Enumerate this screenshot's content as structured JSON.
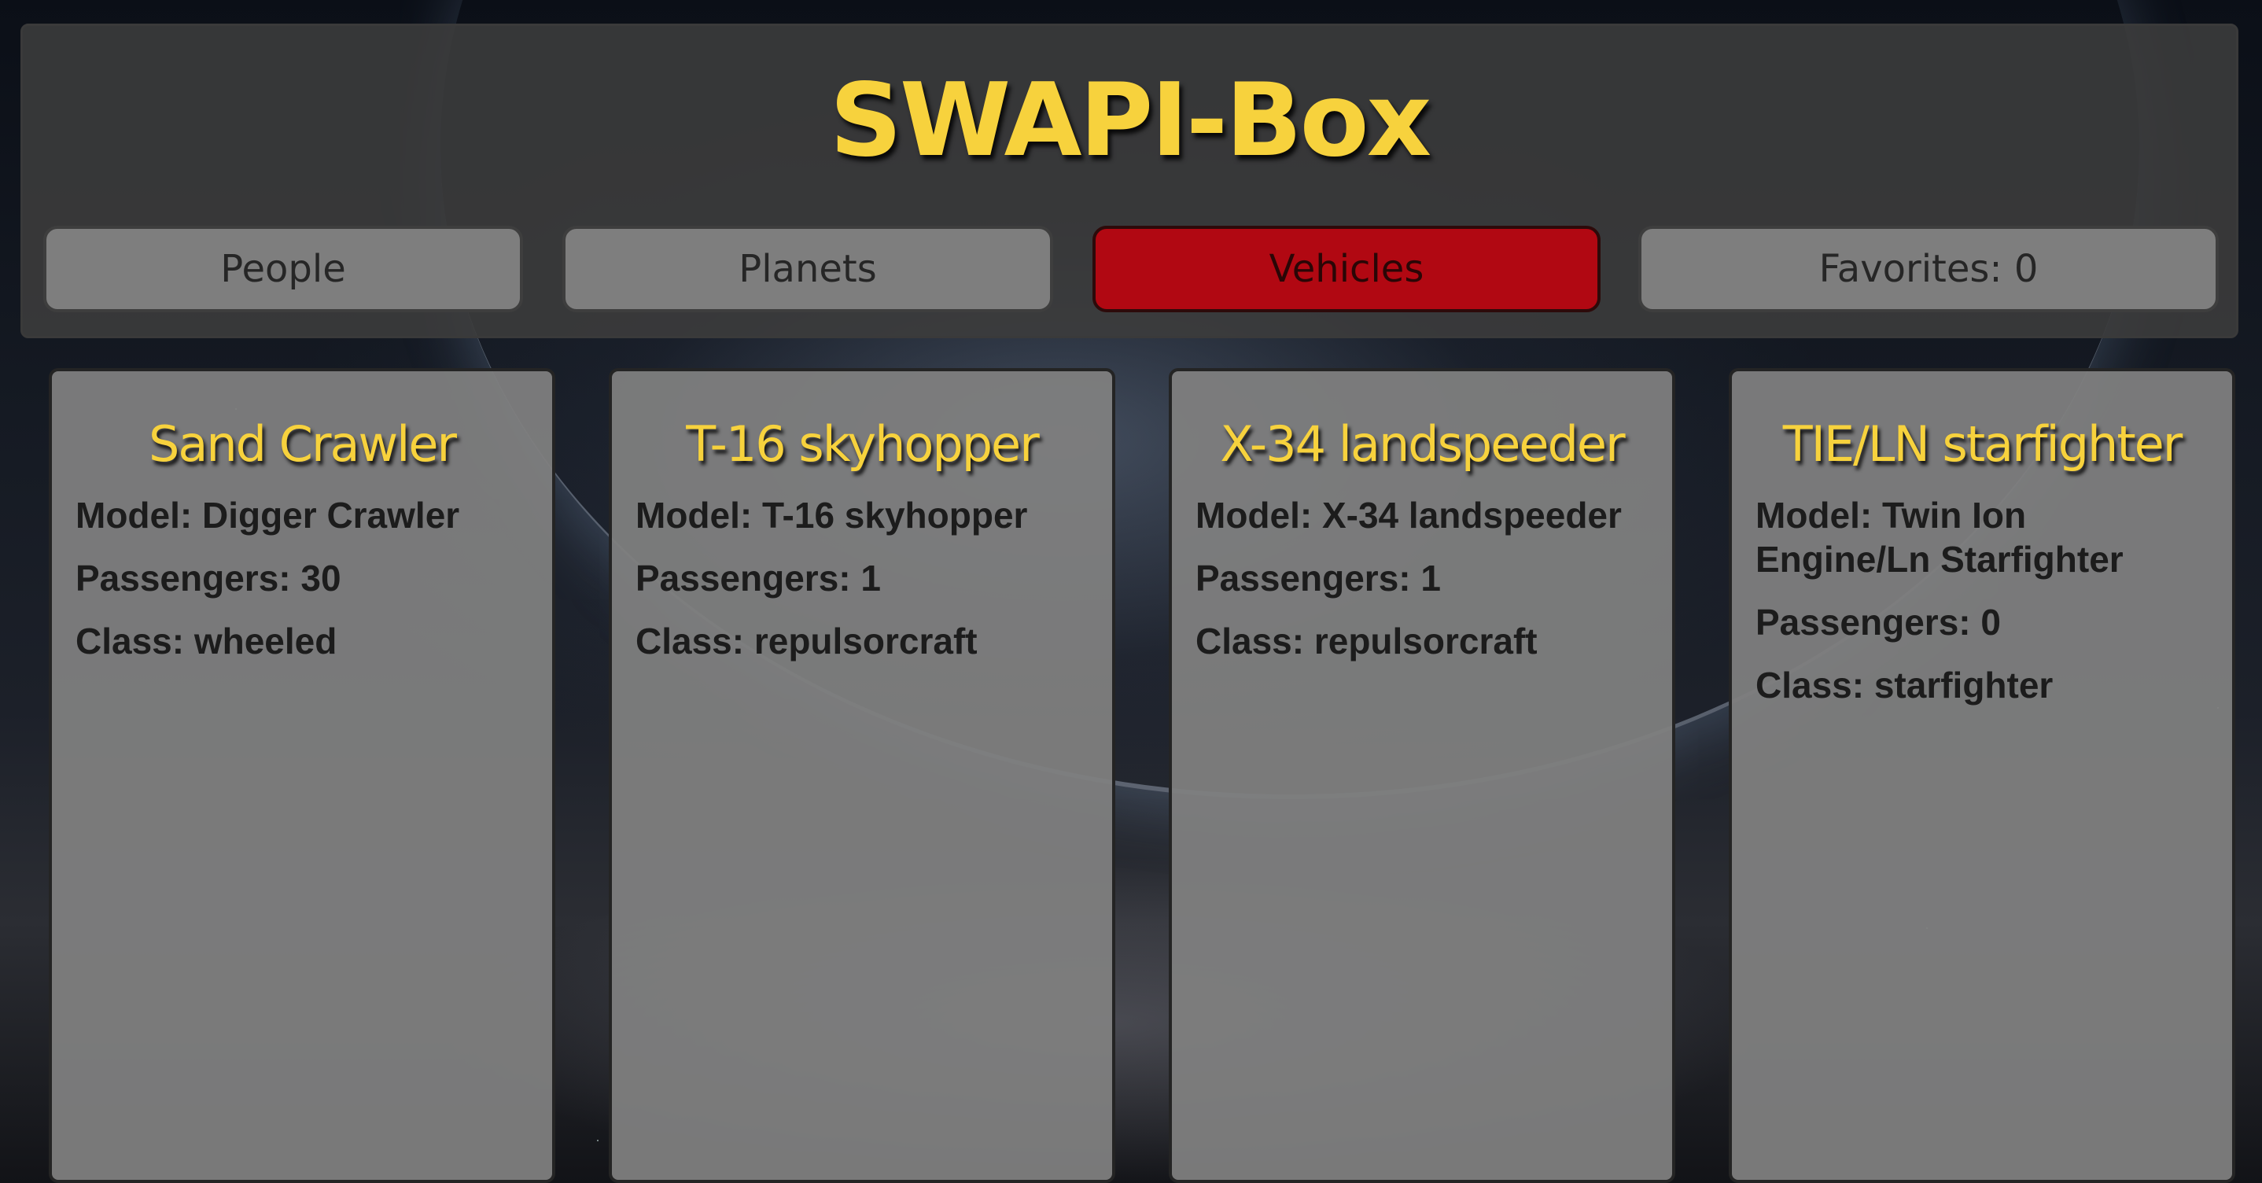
{
  "app": {
    "title": "SWAPI-Box"
  },
  "nav": {
    "people_label": "People",
    "planets_label": "Planets",
    "vehicles_label": "Vehicles",
    "favorites_label": "Favorites: 0",
    "active": "vehicles"
  },
  "colors": {
    "title_yellow": "#f7d23d",
    "active_red": "#b10812",
    "button_gray": "#7e7e7e",
    "card_gray": "#808080"
  },
  "cards": [
    {
      "name": "Sand Crawler",
      "model": "Model: Digger Crawler",
      "passengers": "Passengers: 30",
      "class": "Class: wheeled"
    },
    {
      "name": "T-16 skyhopper",
      "model": "Model: T-16 skyhopper",
      "passengers": "Passengers: 1",
      "class": "Class: repulsorcraft"
    },
    {
      "name": "X-34 landspeeder",
      "model": "Model: X-34 landspeeder",
      "passengers": "Passengers: 1",
      "class": "Class: repulsorcraft"
    },
    {
      "name": "TIE/LN starfighter",
      "model": "Model: Twin Ion Engine/Ln Starfighter",
      "passengers": "Passengers: 0",
      "class": "Class: starfighter"
    }
  ]
}
